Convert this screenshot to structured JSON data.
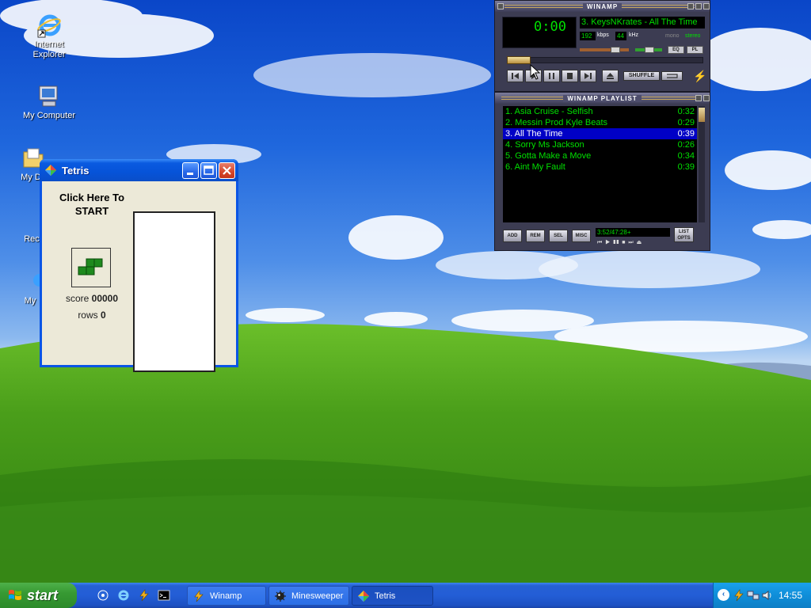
{
  "desktop": {
    "icons": [
      {
        "label": "Internet Explorer"
      },
      {
        "label": "My Computer"
      },
      {
        "label": "My Do"
      },
      {
        "label": "Rec"
      },
      {
        "label": "My"
      }
    ]
  },
  "tetris": {
    "title": "Tetris",
    "start_text": "Click Here To START",
    "score_label": "score",
    "score_value": "00000",
    "rows_label": "rows",
    "rows_value": "0"
  },
  "winamp": {
    "title": "WINAMP",
    "time": "0:00",
    "marquee": "3. KeysNKrates - All The Time",
    "kbps": "192",
    "kbps_unit": "kbps",
    "khz": "44",
    "khz_unit": "kHz",
    "mono": "mono",
    "stereo": "stereo",
    "eq_label": "EQ",
    "pl_label": "PL",
    "shuffle_label": "SHUFFLE",
    "controls": [
      "previous",
      "play",
      "pause",
      "stop",
      "next",
      "eject"
    ]
  },
  "playlist": {
    "title": "WINAMP PLAYLIST",
    "items": [
      {
        "name": "1. Asia Cruise - Selfish",
        "time": "0:32"
      },
      {
        "name": "2. Messin Prod Kyle Beats",
        "time": "0:29"
      },
      {
        "name": "3. All The Time",
        "time": "0:39"
      },
      {
        "name": "4. Sorry Ms Jackson",
        "time": "0:26"
      },
      {
        "name": "5. Gotta Make a Move",
        "time": "0:34"
      },
      {
        "name": "6. Aint My Fault",
        "time": "0:39"
      }
    ],
    "active_index": 2,
    "buttons": {
      "add": "ADD",
      "rem": "REM",
      "sel": "SEL",
      "misc": "MISC",
      "list": "LIST OPTS"
    },
    "time_display": "3:52/47:28+"
  },
  "taskbar": {
    "start_label": "start",
    "tasks": [
      {
        "label": "Winamp",
        "active": false
      },
      {
        "label": "Minesweeper",
        "active": false
      },
      {
        "label": "Tetris",
        "active": true
      }
    ],
    "clock": "14:55"
  },
  "colors": {
    "xp_blue": "#0a55e6",
    "winamp_green": "#00e000",
    "playlist_active": "#0000c6",
    "start_green": "#379a33"
  }
}
